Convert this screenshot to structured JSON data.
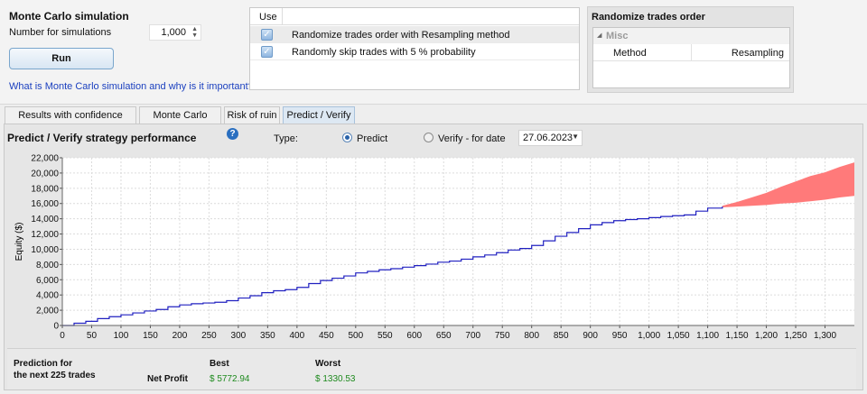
{
  "mc": {
    "title": "Monte Carlo simulation",
    "number_label": "Number for simulations",
    "number_value": "1,000",
    "run_label": "Run",
    "link_text": "What is Monte Carlo simulation and why is it important?"
  },
  "use_table": {
    "header": "Use",
    "rows": [
      {
        "checked": true,
        "label": "Randomize trades order with Resampling method"
      },
      {
        "checked": true,
        "label": "Randomly skip trades with 5 % probability"
      }
    ]
  },
  "randomize_panel": {
    "title": "Randomize trades order",
    "group": "Misc",
    "property": "Method",
    "value": "Resampling"
  },
  "tabs": [
    {
      "label": "Results with confidence levels",
      "active": false
    },
    {
      "label": "Monte Carlo Chart",
      "active": false
    },
    {
      "label": "Risk of ruin",
      "active": false
    },
    {
      "label": "Predict / Verify",
      "active": true
    }
  ],
  "predict": {
    "title": "Predict / Verify strategy performance",
    "type_label": "Type:",
    "option_predict": "Predict",
    "option_verify": "Verify - for date",
    "selected_option": "Predict",
    "date": "27.06.2023"
  },
  "prediction": {
    "label_line1": "Prediction for",
    "label_line2": "the next 225 trades",
    "metric_label": "Net Profit",
    "best_label": "Best",
    "worst_label": "Worst",
    "best_value": "$ 5772.94",
    "worst_value": "$ 1330.53"
  },
  "colors": {
    "equity_line": "#2020c0",
    "prediction_band": "#ff7a7a",
    "positive_value": "#1e8a1e"
  },
  "chart_data": {
    "type": "area",
    "xlabel": "",
    "ylabel": "Equity ($)",
    "xlim": [
      0,
      1350
    ],
    "ylim": [
      0,
      22000
    ],
    "x_ticks": [
      0,
      50,
      100,
      150,
      200,
      250,
      300,
      350,
      400,
      450,
      500,
      550,
      600,
      650,
      700,
      750,
      800,
      850,
      900,
      950,
      1000,
      1050,
      1100,
      1150,
      1200,
      1250,
      1300
    ],
    "x_tick_labels": [
      "0",
      "50",
      "100",
      "150",
      "200",
      "250",
      "300",
      "350",
      "400",
      "450",
      "500",
      "550",
      "600",
      "650",
      "700",
      "750",
      "800",
      "850",
      "900",
      "950",
      "1,000",
      "1,050",
      "1,100",
      "1,150",
      "1,200",
      "1,250",
      "1,300"
    ],
    "y_ticks": [
      0,
      2000,
      4000,
      6000,
      8000,
      10000,
      12000,
      14000,
      16000,
      18000,
      20000,
      22000
    ],
    "y_tick_labels": [
      "0",
      "2,000",
      "4,000",
      "6,000",
      "8,000",
      "10,000",
      "12,000",
      "14,000",
      "16,000",
      "18,000",
      "20,000",
      "22,000"
    ],
    "grid": true,
    "series": [
      {
        "x": [
          0,
          20,
          40,
          60,
          80,
          100,
          120,
          140,
          160,
          180,
          200,
          220,
          240,
          260,
          280,
          300,
          320,
          340,
          360,
          380,
          400,
          420,
          440,
          460,
          480,
          500,
          520,
          540,
          560,
          580,
          600,
          620,
          640,
          660,
          680,
          700,
          720,
          740,
          760,
          780,
          800,
          820,
          840,
          860,
          880,
          900,
          920,
          940,
          960,
          980,
          1000,
          1020,
          1040,
          1060,
          1080,
          1100,
          1125
        ],
        "values": [
          0,
          300,
          550,
          900,
          1150,
          1400,
          1650,
          1900,
          2100,
          2450,
          2700,
          2850,
          2950,
          3050,
          3250,
          3600,
          3900,
          4300,
          4550,
          4700,
          5000,
          5500,
          5900,
          6200,
          6500,
          6900,
          7100,
          7300,
          7450,
          7650,
          7850,
          8050,
          8300,
          8450,
          8700,
          9000,
          9250,
          9550,
          9900,
          10100,
          10500,
          11100,
          11700,
          12200,
          12700,
          13200,
          13500,
          13750,
          13900,
          14000,
          14150,
          14300,
          14400,
          14500,
          15000,
          15400,
          15600
        ]
      },
      {
        "name": "",
        "x": [
          1125,
          1150,
          1175,
          1200,
          1225,
          1250,
          1275,
          1300,
          1325,
          1350
        ],
        "upper": [
          15700,
          16200,
          16800,
          17400,
          18200,
          18900,
          19600,
          20100,
          20800,
          21400
        ],
        "lower": [
          15500,
          15600,
          15700,
          15800,
          16000,
          16100,
          16300,
          16500,
          16800,
          17000
        ]
      }
    ]
  }
}
